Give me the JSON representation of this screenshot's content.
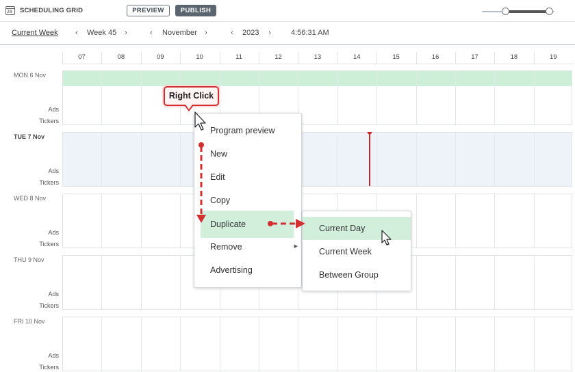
{
  "app": {
    "icon_text": "28",
    "title": "SCHEDULING GRID",
    "preview_label": "PREVIEW",
    "publish_label": "PUBLISH",
    "zoom_slider": {
      "low": 0.33,
      "high": 0.93
    }
  },
  "nav": {
    "current_week_label": "Current Week",
    "week": "Week 45",
    "month": "November",
    "year": "2023",
    "clock": "4:56:31 AM",
    "prev_icon": "chevron-left-icon",
    "next_icon": "chevron-right-icon"
  },
  "grid": {
    "hours": [
      "07",
      "08",
      "09",
      "10",
      "11",
      "12",
      "13",
      "14",
      "15",
      "16",
      "17",
      "18",
      "19"
    ],
    "days": [
      {
        "label": "MON 6 Nov",
        "ads": "Ads",
        "tickers": "Tickers"
      },
      {
        "label": "TUE 7 Nov",
        "ads": "Ads",
        "tickers": "Tickers"
      },
      {
        "label": "WED 8 Nov",
        "ads": "Ads",
        "tickers": "Tickers"
      },
      {
        "label": "THU 9 Nov",
        "ads": "Ads",
        "tickers": "Tickers"
      },
      {
        "label": "FRI 10 Nov",
        "ads": "Ads",
        "tickers": "Tickers"
      }
    ],
    "highlight_color": "#cdeed7",
    "current_time_color": "#c62828"
  },
  "context_menu": {
    "items": [
      "Program preview",
      "New",
      "Edit",
      "Copy",
      "Duplicate",
      "Remove",
      "Advertising"
    ],
    "submenu_caret": "caret-right-icon"
  },
  "submenu": {
    "items": [
      "Current Day",
      "Current Week",
      "Between Group"
    ]
  },
  "annotation": {
    "callout": "Right Click",
    "color": "#d32f2f"
  }
}
